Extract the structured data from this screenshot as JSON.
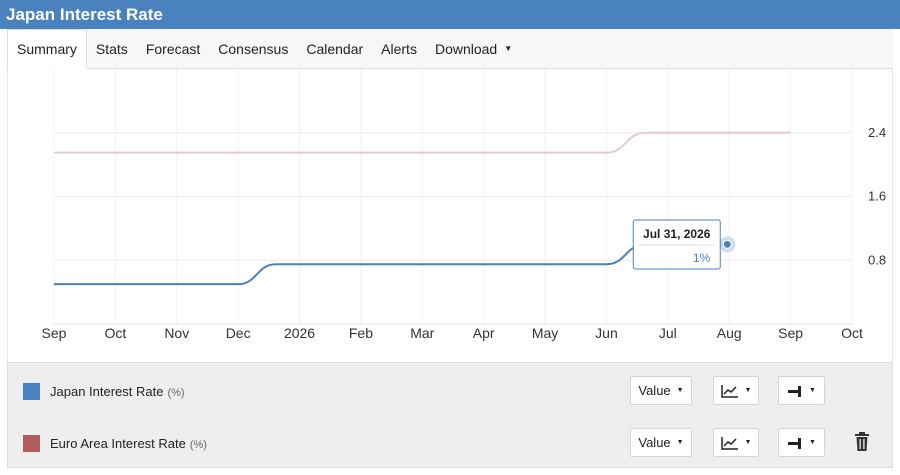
{
  "header": {
    "title": "Japan Interest Rate"
  },
  "tabs": [
    {
      "label": "Summary",
      "active": true
    },
    {
      "label": "Stats"
    },
    {
      "label": "Forecast"
    },
    {
      "label": "Consensus"
    },
    {
      "label": "Calendar"
    },
    {
      "label": "Alerts"
    },
    {
      "label": "Download",
      "dropdown": true
    }
  ],
  "tooltip": {
    "date": "Jul 31, 2026",
    "value": "1%"
  },
  "legend": [
    {
      "name": "Japan Interest Rate",
      "unit": "(%)",
      "color": "#4a81bf",
      "value_label": "Value",
      "chart_type_icon": "line-chart-icon",
      "axis_icon": "axis-position-icon"
    },
    {
      "name": "Euro Area Interest Rate",
      "unit": "(%)",
      "color": "#b55c5c",
      "value_label": "Value",
      "chart_type_icon": "line-chart-icon",
      "axis_icon": "axis-position-icon",
      "delete_icon": "trash-icon"
    }
  ],
  "chart_data": {
    "type": "line",
    "x_ticks": [
      "Sep",
      "Oct",
      "Nov",
      "Dec",
      "2026",
      "Feb",
      "Mar",
      "Apr",
      "May",
      "Jun",
      "Jul",
      "Aug",
      "Sep",
      "Oct"
    ],
    "y_ticks": [
      "0.8",
      "1.6",
      "2.4"
    ],
    "ylim": [
      0,
      3.2
    ],
    "grid": true,
    "series": [
      {
        "name": "Japan Interest Rate",
        "color": "#4a81bf",
        "x": [
          "2025-09-01",
          "2025-12-01",
          "2025-12-20",
          "2026-06-01",
          "2026-06-20",
          "2026-07-31"
        ],
        "values": [
          0.5,
          0.5,
          0.75,
          0.75,
          1.0,
          1.0
        ]
      },
      {
        "name": "Euro Area Interest Rate",
        "color": "#e8c8cc",
        "x": [
          "2025-09-01",
          "2026-06-01",
          "2026-06-20",
          "2026-09-01"
        ],
        "values": [
          2.15,
          2.15,
          2.4,
          2.4
        ]
      }
    ],
    "tooltip_point": {
      "x": "2026-07-31",
      "value": 1
    }
  }
}
